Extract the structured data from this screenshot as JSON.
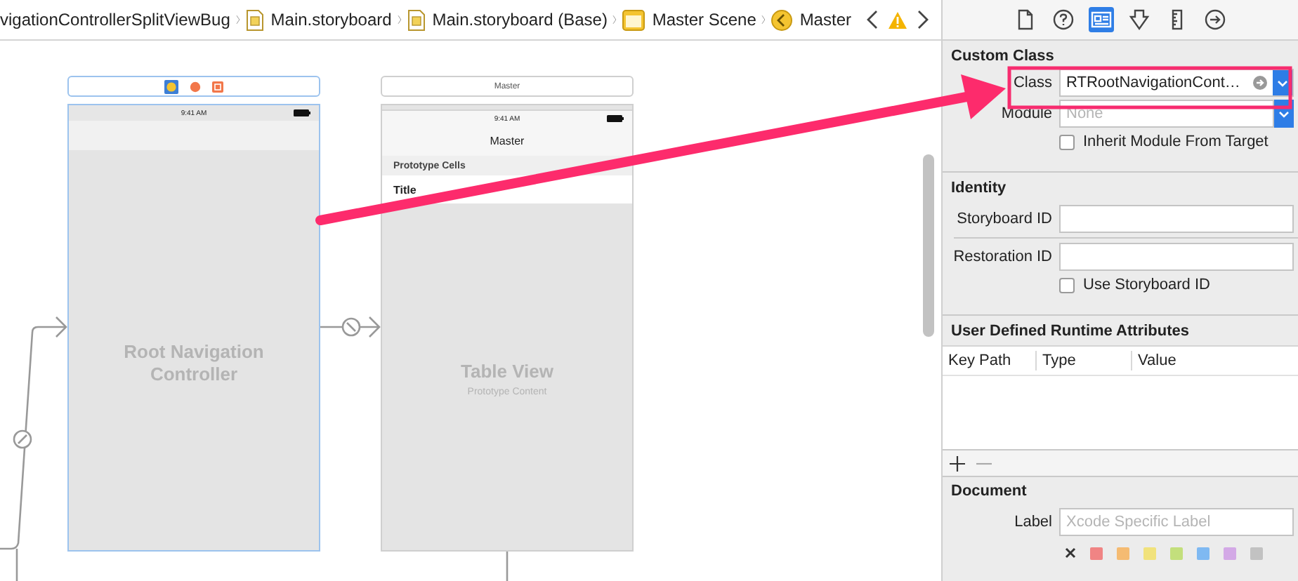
{
  "jump_bar": {
    "crumbs": [
      {
        "label": "vigationControllerSplitViewBug"
      },
      {
        "label": "Main.storyboard"
      },
      {
        "label": "Main.storyboard (Base)"
      },
      {
        "label": "Master Scene"
      },
      {
        "label": "Master"
      }
    ]
  },
  "canvas": {
    "scenes": [
      {
        "kind": "navigation",
        "selected": true,
        "time": "9:41 AM",
        "title": "Root Navigation Controller"
      },
      {
        "kind": "table",
        "selected": false,
        "dock_title": "Master",
        "time": "9:41 AM",
        "nav_title": "Master",
        "section": "Prototype Cells",
        "cell": "Title",
        "title": "Table View",
        "subtitle": "Prototype Content"
      }
    ]
  },
  "inspector": {
    "tabs": [
      {
        "selected": false
      },
      {
        "selected": false
      },
      {
        "selected": true
      },
      {
        "selected": false
      },
      {
        "selected": false
      },
      {
        "selected": false
      }
    ],
    "custom_class": {
      "heading": "Custom Class",
      "class_label": "Class",
      "class_value": "RTRootNavigationCont…",
      "module_label": "Module",
      "module_placeholder": "None",
      "inherit_label": "Inherit Module From Target",
      "inherit_checked": false
    },
    "identity": {
      "heading": "Identity",
      "storyboard_id_label": "Storyboard ID",
      "restoration_id_label": "Restoration ID",
      "use_storyboard_id_label": "Use Storyboard ID",
      "use_storyboard_id_checked": false
    },
    "runtime_attributes": {
      "heading": "User Defined Runtime Attributes",
      "columns": [
        "Key Path",
        "Type",
        "Value"
      ]
    },
    "document": {
      "heading": "Document",
      "label_label": "Label",
      "label_placeholder": "Xcode Specific Label",
      "colors": [
        {
          "color": "#f08484"
        },
        {
          "color": "#f5bb72"
        },
        {
          "color": "#f1e27c"
        },
        {
          "color": "#c3df7c"
        },
        {
          "color": "#7fb9f2"
        },
        {
          "color": "#d3a9e6"
        },
        {
          "color": "#c2c2c2"
        }
      ]
    }
  }
}
